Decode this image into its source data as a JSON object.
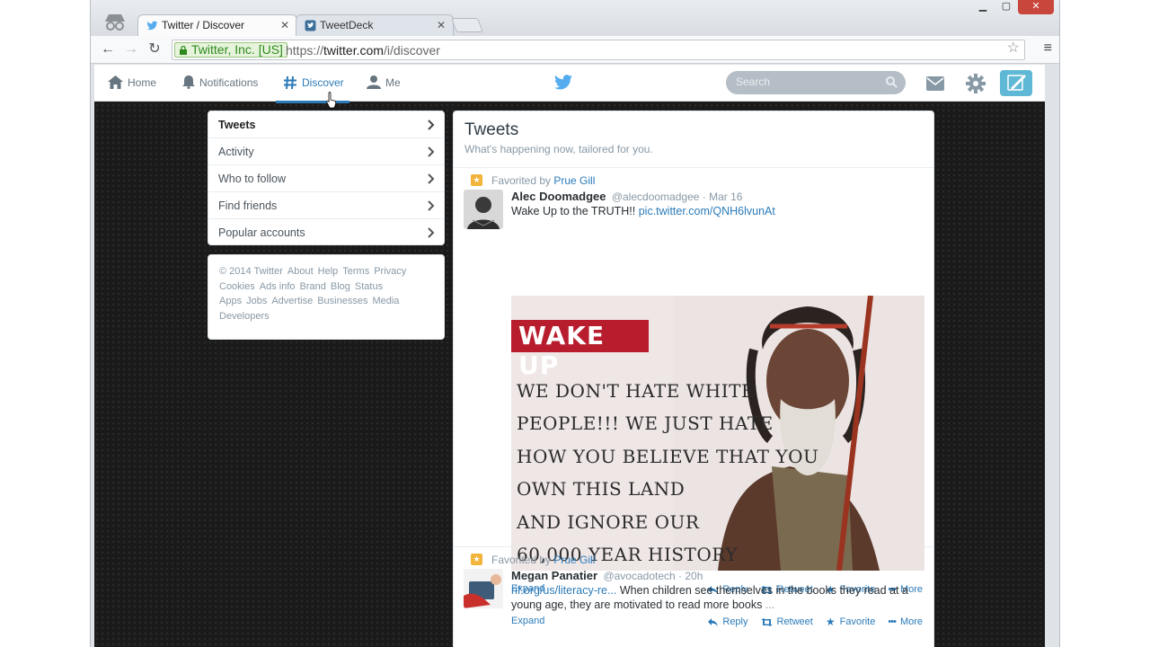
{
  "browser": {
    "tabs": [
      {
        "title": "Twitter / Discover",
        "active": true
      },
      {
        "title": "TweetDeck",
        "active": false
      }
    ],
    "ev_label": "Twitter, Inc. [US]",
    "url_scheme": "https://",
    "url_host": "twitter.com",
    "url_path": "/i/discover"
  },
  "topnav": {
    "home": "Home",
    "notifications": "Notifications",
    "discover": "Discover",
    "me": "Me",
    "search_placeholder": "Search"
  },
  "sidenav": {
    "items": [
      "Tweets",
      "Activity",
      "Who to follow",
      "Find friends",
      "Popular accounts"
    ],
    "selected": "Tweets"
  },
  "footer": {
    "links": [
      "© 2014 Twitter",
      "About",
      "Help",
      "Terms",
      "Privacy",
      "Cookies",
      "Ads info",
      "Brand",
      "Blog",
      "Status",
      "Apps",
      "Jobs",
      "Advertise",
      "Businesses",
      "Media",
      "Developers"
    ]
  },
  "stream": {
    "title": "Tweets",
    "subtitle": "What's happening now, tailored for you.",
    "tweets": [
      {
        "context_prefix": "Favorited by ",
        "context_user": "Prue Gill",
        "fullname": "Alec Doomadgee",
        "username": "@alecdoomadgee",
        "sep": "·",
        "time": "Mar 16",
        "text": "Wake Up to the TRUTH!! ",
        "link": "pic.twitter.com/QNH6lvunAt",
        "media": {
          "banner": "WAKE UP",
          "lines": [
            "WE DON'T HATE WHITE",
            "PEOPLE!!! WE JUST HATE",
            "HOW YOU BELIEVE THAT YOU",
            "OWN THIS LAND",
            "AND IGNORE OUR",
            "60,000 YEAR HISTORY"
          ]
        }
      },
      {
        "context_prefix": "Favorited by ",
        "context_user": "Prue Gill",
        "fullname": "Megan Panatier",
        "username": "@avocadotech",
        "sep": "·",
        "time": "20h",
        "link": "rif.org/us/literacy-re...",
        "text": " When children see themselves in the books they read at a young age, they are motivated to read more books",
        "ellipsis": " ..."
      }
    ],
    "actions": {
      "expand": "Expand",
      "reply": "Reply",
      "retweet": "Retweet",
      "favorite": "Favorite",
      "more": "More"
    }
  },
  "colors": {
    "twitter_blue": "#2b7bb9",
    "logo_blue": "#55acee",
    "banner_red": "#b81d2e",
    "star_gold": "#f2b43a"
  }
}
